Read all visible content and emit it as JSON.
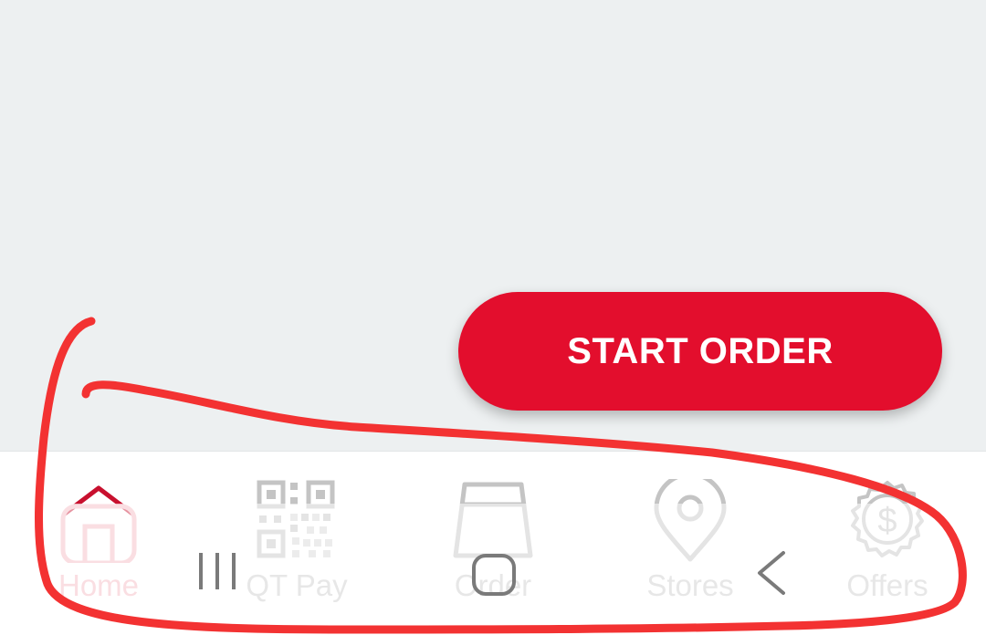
{
  "main": {
    "start_order_label": "START ORDER"
  },
  "bottom_nav": {
    "items": [
      {
        "label": "Home",
        "icon": "home-icon",
        "active": true
      },
      {
        "label": "QT Pay",
        "icon": "qr-code-icon",
        "active": false
      },
      {
        "label": "Order",
        "icon": "cup-icon",
        "active": false
      },
      {
        "label": "Stores",
        "icon": "location-pin-icon",
        "active": false
      },
      {
        "label": "Offers",
        "icon": "dollar-badge-icon",
        "active": false
      }
    ]
  },
  "system_nav": {
    "buttons": [
      "recent-apps-icon",
      "home-button-icon",
      "back-icon"
    ]
  },
  "colors": {
    "accent": "#e30e2d",
    "background": "#edf0f1",
    "nav_inactive": "#c9c9c9",
    "annotation": "#ff2a2a"
  }
}
